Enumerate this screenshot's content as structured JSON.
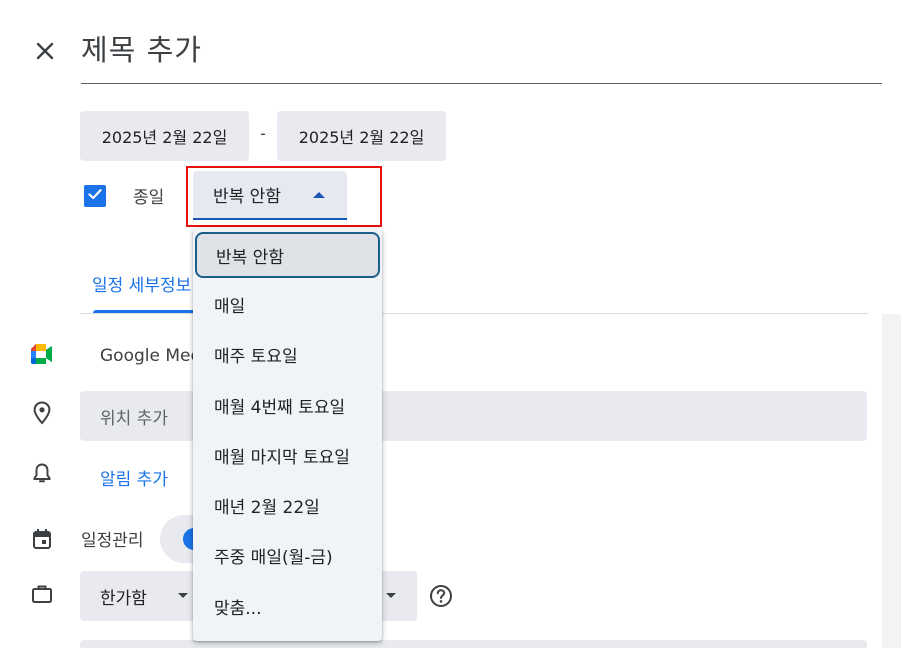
{
  "event": {
    "title_placeholder": "제목 추가",
    "start_date": "2025년 2월 22일",
    "date_separator": "-",
    "end_date": "2025년 2월 22일",
    "all_day_label": "종일",
    "all_day_checked": true
  },
  "repeat": {
    "current": "반복 안함",
    "options": [
      "반복 안함",
      "매일",
      "매주 토요일",
      "매월 4번째 토요일",
      "매월 마지막 토요일",
      "매년 2월 22일",
      "주중 매일(월-금)",
      "맞춤..."
    ],
    "selected_index": 0
  },
  "tabs": {
    "details_label": "일정 세부정보"
  },
  "details": {
    "meet_label": "Google Meet",
    "location_placeholder": "위치 추가",
    "add_alert_label": "알림 추가",
    "schedule_label": "일정관리",
    "busy_label": "한가함"
  },
  "colors": {
    "accent": "#1a73e8",
    "highlight_border": "#e8110f",
    "chip_bg": "#e8eaf0",
    "menu_bg": "#f0f4f9"
  }
}
